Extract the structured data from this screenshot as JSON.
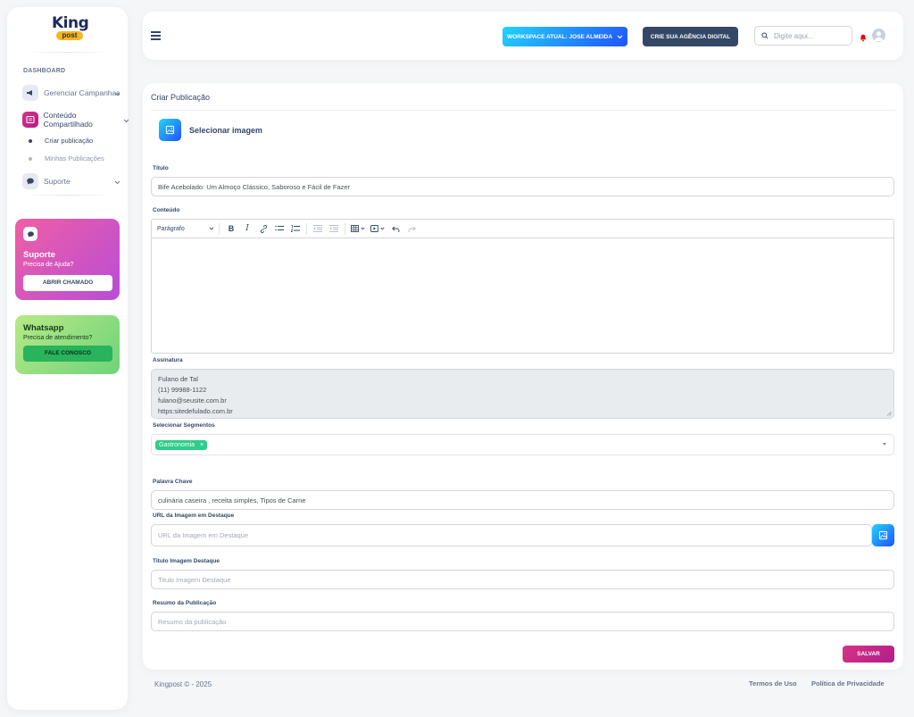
{
  "sidebar": {
    "logo": "King post",
    "section_label": "DASHBOARD",
    "items": [
      {
        "label": "Gerenciar Campanhas",
        "icon": "megaphone-icon"
      },
      {
        "label": "Conteúdo Compartilhado",
        "icon": "newspaper-icon"
      },
      {
        "label": "Suporte",
        "icon": "chat-icon"
      }
    ],
    "subitems": [
      {
        "label": "Criar publicação",
        "active": true
      },
      {
        "label": "Minhas Publicações",
        "active": false
      }
    ],
    "support_card": {
      "title": "Suporte",
      "subtitle": "Precisa de Ajuda?",
      "button": "ABRIR CHAMADO"
    },
    "whatsapp_card": {
      "title": "Whatsapp",
      "subtitle": "Precisa de atendimento?",
      "button": "FALE CONOSCO"
    }
  },
  "topbar": {
    "workspace_button": "WORKSPACE ATUAL: JOSE ALMEIDA",
    "agency_button": "CRIE SUA AGÊNCIA DIGITAL",
    "search_placeholder": "Digite aqui..."
  },
  "main": {
    "title": "Criar Publicação",
    "select_image_label": "Selecionar imagem",
    "fields": {
      "titulo_label": "Título",
      "titulo_value": "Bife Acebolado: Um Almoço Clássico, Saboroso e Fácil de Fazer",
      "conteudo_label": "Conteúdo",
      "editor_block_format": "Parágrafo",
      "assinatura_label": "Assinatura",
      "assinatura_lines": [
        "Fulano de Tal",
        "(11) 99988-1122",
        "fulano@seusite.com.br",
        "https:sitedefulado.com.br"
      ],
      "segmentos_label": "Selecionar Segmentos",
      "segmento_tag": "Gastronomia",
      "palavra_chave_label": "Palavra Chave",
      "palavra_chave_value": "culinária caseira , receita simples, Tipos de Carne",
      "url_imagem_label": "URL da Imagem em Destaque",
      "url_imagem_placeholder": "URL da Imagem em Destaque",
      "titulo_imagem_label": "Titulo Imagem Destaque",
      "titulo_imagem_placeholder": "Titulo Imagem Destaque",
      "resumo_label": "Resumo da Publicação",
      "resumo_placeholder": "Resumo da publicação"
    },
    "save_button": "SALVAR"
  },
  "footer": {
    "copyright": "Kingpost © - 2025",
    "terms": "Termos de Uso",
    "privacy": "Política de Privacidade"
  },
  "colors": {
    "primary_gradient_start": "#21d4fd",
    "primary_gradient_end": "#2152ff",
    "accent_pink": "#d63384",
    "dark": "#344767",
    "success": "#2dce89"
  }
}
